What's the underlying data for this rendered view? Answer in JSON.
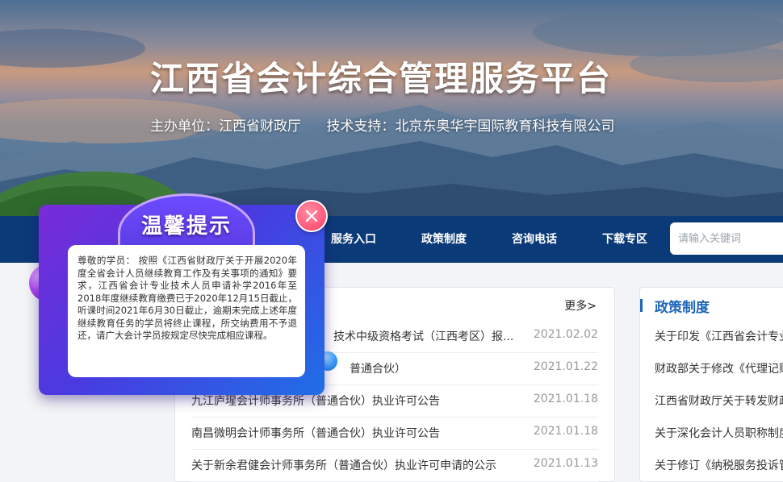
{
  "header": {
    "title": "江西省会计综合管理服务平台",
    "organizer": "主办单位：江西省财政厅",
    "tech_support": "技术支持：北京东奥华宇国际教育科技有限公司"
  },
  "nav": {
    "items": [
      "服务入口",
      "政策制度",
      "咨询电话",
      "下载专区"
    ],
    "search_placeholder": "请输入关键词"
  },
  "news": {
    "more_label": "更多>",
    "rows": [
      {
        "title": "技术中级资格考试（江西考区）报...",
        "date": "2021.02.02"
      },
      {
        "title": "普通合伙）",
        "date": "2021.01.22"
      },
      {
        "title": "九江庐瑆会计师事务所（普通合伙）执业许可公告",
        "date": "2021.01.18"
      },
      {
        "title": "南昌微明会计师事务所（普通合伙）执业许可公告",
        "date": "2021.01.18"
      },
      {
        "title": "关于新余君健会计师事务所（普通合伙）执业许可申请的公示",
        "date": "2021.01.13"
      }
    ]
  },
  "policy": {
    "heading": "政策制度",
    "rows": [
      "关于印发《江西省会计专业",
      "财政部关于修改《代理记账",
      "江西省财政厅关于转发财政",
      "关于深化会计人员职称制度",
      "关于修订《纳税服务投诉管"
    ]
  },
  "popup": {
    "title": "温馨提示",
    "message": "尊敬的学员：  按照《江西省财政厅关于开展2020年度全省会计人员继续教育工作及有关事项的通知》要求，江西省会计专业技术人员申请补学2016年至2018年度继续教育缴费已于2020年12月15日截止，听课时间2021年6月30日截止，逾期未完成上述年度继续教育任务的学员将终止课程，所交纳费用不予退还，请广大会计学员按规定尽快完成相应课程。",
    "close_icon": "close-icon",
    "accent": "#5b3ee6"
  },
  "colors": {
    "nav_bg": "#0b3a78",
    "policy_heading": "#1d66b8"
  }
}
